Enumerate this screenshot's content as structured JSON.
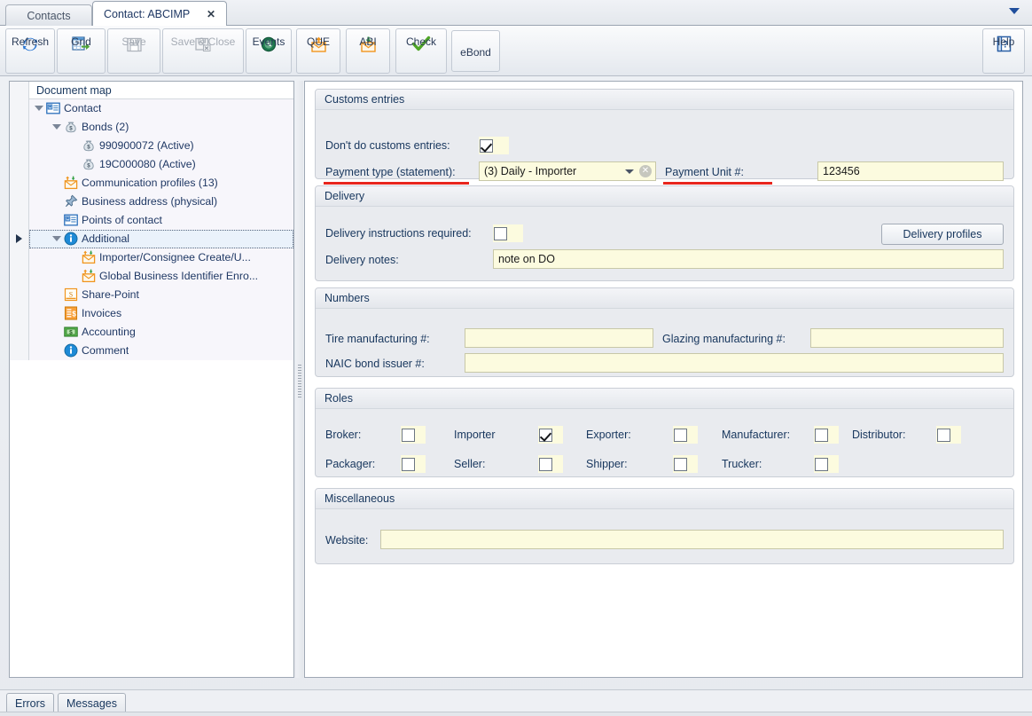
{
  "window": {
    "tabs": [
      {
        "label": "Contacts",
        "active": false
      },
      {
        "label": "Contact: ABCIMP",
        "active": true,
        "close": "✕"
      }
    ],
    "overflow_icon": "chevron-down-icon"
  },
  "toolbar": {
    "buttons": [
      {
        "label": "Refresh",
        "icon": "refresh-icon",
        "enabled": true
      },
      {
        "label": "Grid",
        "icon": "grid-icon",
        "enabled": true
      },
      {
        "label": "Save",
        "icon": "save-icon",
        "enabled": false
      },
      {
        "label": "Save & Close",
        "icon": "save-close-icon",
        "enabled": false
      },
      {
        "label": "Events",
        "icon": "events-clock-icon",
        "enabled": true
      },
      {
        "label": "QUE",
        "icon": "envelope-up-icon",
        "enabled": true
      },
      {
        "label": "ABI",
        "icon": "envelope-down-icon",
        "enabled": true
      },
      {
        "label": "Check",
        "icon": "checkmark-icon",
        "enabled": true
      },
      {
        "label": "eBond",
        "icon": "",
        "enabled": true
      }
    ],
    "help": {
      "label": "Help",
      "icon": "help-book-icon"
    }
  },
  "tree": {
    "header": "Document map",
    "rows": [
      {
        "label": "Contact",
        "icon": "contact-card-icon",
        "indent": 0,
        "expander": true,
        "marker": false,
        "selected": false
      },
      {
        "label": "Bonds (2)",
        "icon": "money-bag-icon",
        "indent": 1,
        "expander": true,
        "marker": false,
        "selected": false
      },
      {
        "label": "990900072 (Active)",
        "icon": "money-bag-icon",
        "indent": 2,
        "expander": false,
        "marker": false,
        "selected": false
      },
      {
        "label": "19C000080 (Active)",
        "icon": "money-bag-icon",
        "indent": 2,
        "expander": false,
        "marker": false,
        "selected": false
      },
      {
        "label": "Communication profiles (13)",
        "icon": "envelope-updown-icon",
        "indent": 1,
        "expander": false,
        "marker": false,
        "selected": false
      },
      {
        "label": "Business address (physical)",
        "icon": "pushpin-icon",
        "indent": 1,
        "expander": false,
        "marker": false,
        "selected": false
      },
      {
        "label": "Points of contact",
        "icon": "contact-card-icon",
        "indent": 1,
        "expander": false,
        "marker": false,
        "selected": false
      },
      {
        "label": "Additional",
        "icon": "info-icon",
        "indent": 1,
        "expander": true,
        "marker": true,
        "selected": true
      },
      {
        "label": "Importer/Consignee Create/U...",
        "icon": "envelope-updown-icon",
        "indent": 2,
        "expander": false,
        "marker": false,
        "selected": false
      },
      {
        "label": "Global Business Identifier Enro...",
        "icon": "envelope-updown-icon",
        "indent": 2,
        "expander": false,
        "marker": false,
        "selected": false
      },
      {
        "label": "Share-Point",
        "icon": "sharepoint-icon",
        "indent": 1,
        "expander": false,
        "marker": false,
        "selected": false
      },
      {
        "label": "Invoices",
        "icon": "invoice-icon",
        "indent": 1,
        "expander": false,
        "marker": false,
        "selected": false
      },
      {
        "label": "Accounting",
        "icon": "accounting-money-icon",
        "indent": 1,
        "expander": false,
        "marker": false,
        "selected": false
      },
      {
        "label": "Comment",
        "icon": "info-icon",
        "indent": 1,
        "expander": false,
        "marker": false,
        "selected": false
      }
    ]
  },
  "form": {
    "customs": {
      "title": "Customs entries",
      "dont_do_label": "Don't do customs entries:",
      "dont_do_checked": true,
      "payment_type_label": "Payment type (statement):",
      "payment_type_value": "(3) Daily - Importer",
      "payment_type_clear_icon": "clear-circle-icon",
      "payment_unit_label": "Payment Unit #:",
      "payment_unit_value": "123456"
    },
    "delivery": {
      "title": "Delivery",
      "instructions_label": "Delivery instructions required:",
      "instructions_checked": false,
      "profiles_button": "Delivery profiles",
      "notes_label": "Delivery notes:",
      "notes_value": "note on DO"
    },
    "numbers": {
      "title": "Numbers",
      "tire_label": "Tire manufacturing #:",
      "tire_value": "",
      "glazing_label": "Glazing manufacturing #:",
      "glazing_value": "",
      "naic_label": "NAIC bond issuer #:",
      "naic_value": ""
    },
    "roles": {
      "title": "Roles",
      "items": [
        {
          "label": "Broker:",
          "checked": false
        },
        {
          "label": "Importer",
          "checked": true
        },
        {
          "label": "Exporter:",
          "checked": false
        },
        {
          "label": "Manufacturer:",
          "checked": false
        },
        {
          "label": "Distributor:",
          "checked": false
        },
        {
          "label": "Packager:",
          "checked": false
        },
        {
          "label": "Seller:",
          "checked": false
        },
        {
          "label": "Shipper:",
          "checked": false
        },
        {
          "label": "Trucker:",
          "checked": false
        }
      ]
    },
    "misc": {
      "title": "Miscellaneous",
      "website_label": "Website:",
      "website_value": ""
    }
  },
  "status": {
    "tabs": [
      {
        "label": "Errors"
      },
      {
        "label": "Messages"
      }
    ]
  },
  "colors": {
    "accent": "#1f4e9c",
    "field_bg": "#fcfbdf",
    "annotation_red": "#e8251d",
    "text": "#17365d"
  }
}
